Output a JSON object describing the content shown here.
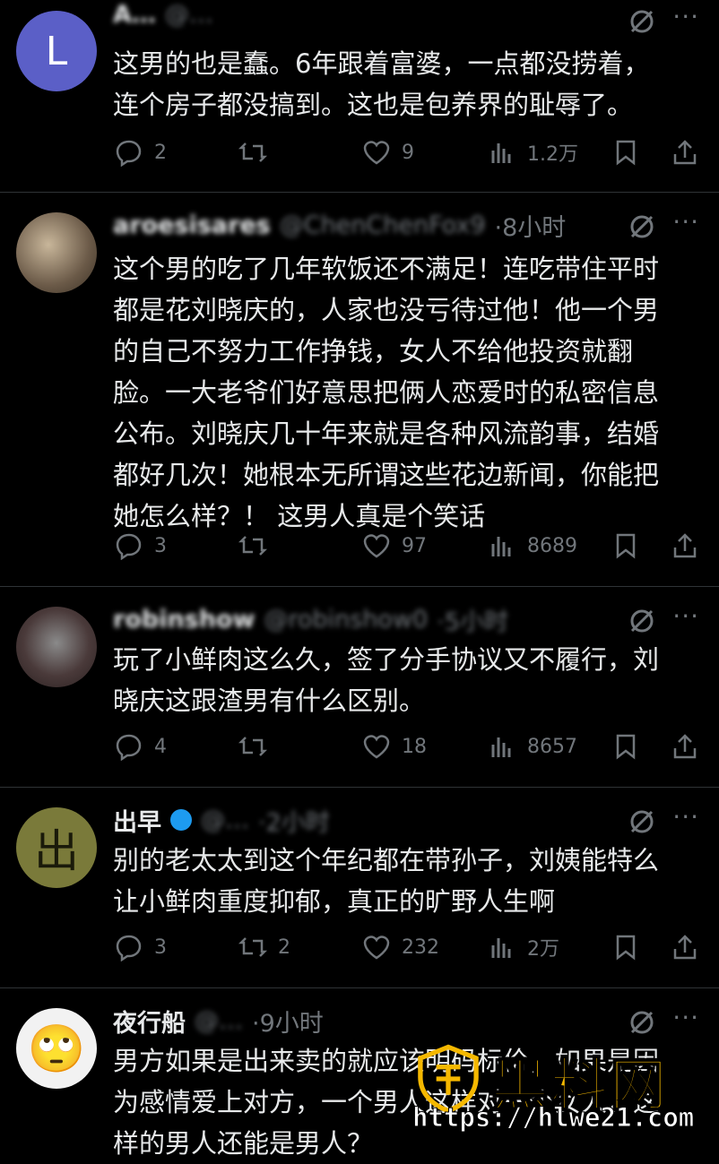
{
  "posts": [
    {
      "name": "A…",
      "handle": "@…",
      "avatar_letter": "L",
      "avatar_color": "#5b5fc7",
      "text_lines": [
        "这男的也是蠢。6年跟着富婆，一点都没捞着，",
        "连个房子都没搞到。这也是包养界的耻辱了。"
      ],
      "replies": "2",
      "reposts": "",
      "likes": "9",
      "views": "1.2万"
    },
    {
      "name": "aroesisares",
      "handle": "@ChenChenFox9",
      "time": "·8小时",
      "text_lines": [
        "这个男的吃了几年软饭还不满足！连吃带住平时",
        "都是花刘晓庆的，人家也没亏待过他！他一个男",
        "的自己不努力工作挣钱，女人不给他投资就翻",
        "脸。一大老爷们好意思把俩人恋爱时的私密信息",
        "公布。刘晓庆几十年来就是各种风流韵事，结婚",
        "都好几次！她根本无所谓这些花边新闻，你能把",
        "她怎么样？！ 这男人真是个笑话"
      ],
      "replies": "3",
      "reposts": "",
      "likes": "97",
      "views": "8689"
    },
    {
      "name": "robinshow",
      "handle": "@robinshow0",
      "time": "·5小时",
      "text_lines": [
        "玩了小鲜肉这么久，签了分手协议又不履行，刘",
        "晓庆这跟渣男有什么区别。"
      ],
      "replies": "4",
      "reposts": "",
      "likes": "18",
      "views": "8657"
    },
    {
      "name": "出早",
      "handle": "@…",
      "time": "·2小时",
      "avatar_glyph": "出",
      "avatar_color": "#7a7a3a",
      "text_lines": [
        "别的老太太到这个年纪都在带孙子，刘姨能特么",
        "让小鲜肉重度抑郁，真正的旷野人生啊"
      ],
      "replies": "3",
      "reposts": "2",
      "likes": "232",
      "views": "2万"
    },
    {
      "name": "夜行船",
      "handle": "@…",
      "time": "·9小时",
      "avatar_glyph": "🙄",
      "text_lines": [
        "男方如果是出来卖的就应该明码标价，如果是因",
        "为感情爱上对方，一个男人这样对一个女人，这",
        "样的男人还能是男人？"
      ],
      "replies": "",
      "reposts": "",
      "likes": "",
      "views": ""
    }
  ],
  "watermark": {
    "title": "黑料网",
    "url": "https://hlwe21.com"
  }
}
